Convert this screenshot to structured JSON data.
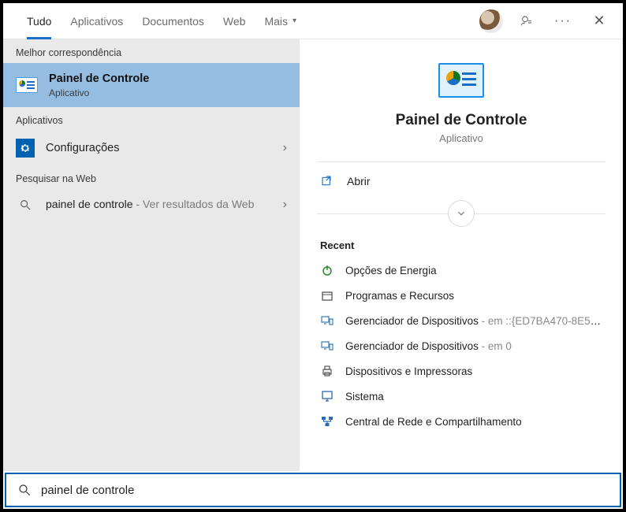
{
  "tabs": {
    "all": "Tudo",
    "apps": "Aplicativos",
    "docs": "Documentos",
    "web": "Web",
    "more": "Mais"
  },
  "sections": {
    "best_match": "Melhor correspondência",
    "apps": "Aplicativos",
    "web_search": "Pesquisar na Web"
  },
  "best": {
    "title": "Painel de Controle",
    "subtitle": "Aplicativo"
  },
  "apps_list": {
    "settings": "Configurações"
  },
  "web": {
    "query": "painel de controle",
    "suffix": " - Ver resultados da Web"
  },
  "preview": {
    "title": "Painel de Controle",
    "subtitle": "Aplicativo",
    "open": "Abrir",
    "recent_header": "Recent",
    "recent": [
      {
        "icon": "power",
        "label": "Opções de Energia",
        "suffix": ""
      },
      {
        "icon": "box",
        "label": "Programas e Recursos",
        "suffix": ""
      },
      {
        "icon": "device",
        "label": "Gerenciador de Dispositivos",
        "suffix": " - em ::{ED7BA470-8E54-465E..."
      },
      {
        "icon": "device",
        "label": "Gerenciador de Dispositivos",
        "suffix": " - em 0"
      },
      {
        "icon": "printer",
        "label": "Dispositivos e Impressoras",
        "suffix": ""
      },
      {
        "icon": "monitor",
        "label": "Sistema",
        "suffix": ""
      },
      {
        "icon": "network",
        "label": "Central de Rede e Compartilhamento",
        "suffix": ""
      }
    ]
  },
  "search": {
    "value": "painel de controle"
  }
}
